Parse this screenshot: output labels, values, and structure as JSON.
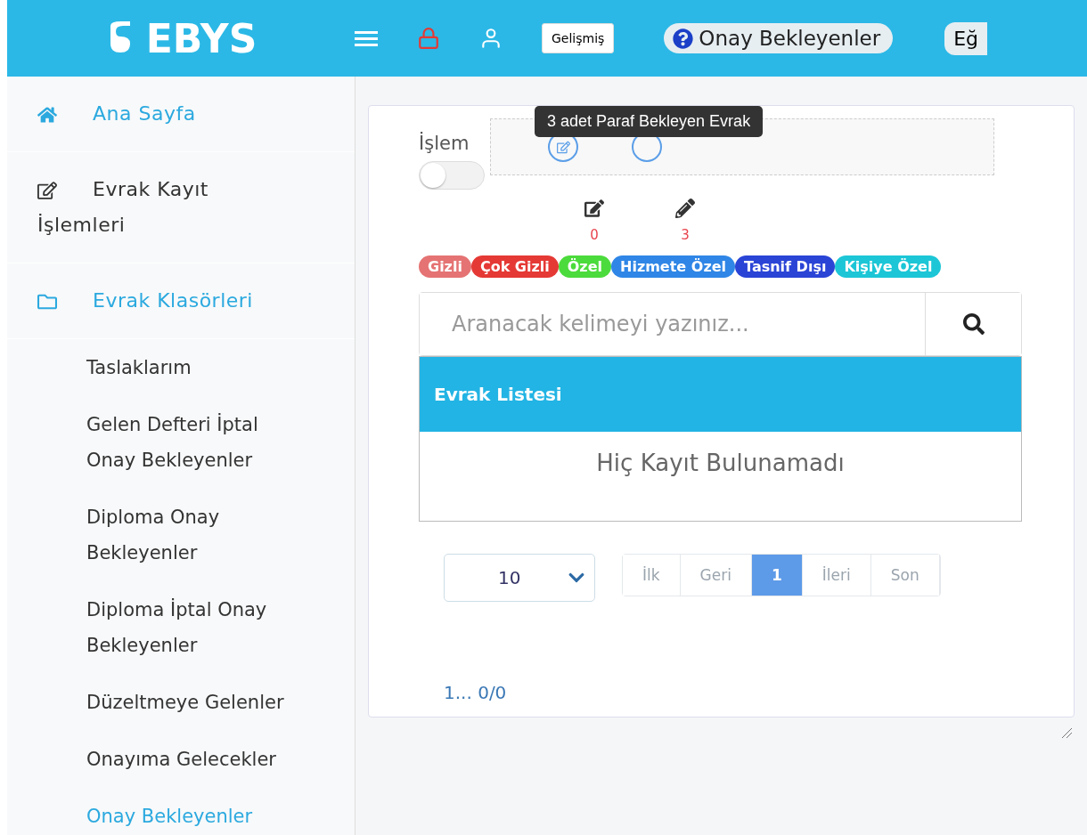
{
  "header": {
    "logo": "EBYS",
    "advanced_button": "Gelişmiş",
    "page_title": "Onay Bekleyenler",
    "cut_button": "Eğ"
  },
  "sidebar": {
    "items": [
      {
        "label": "Ana Sayfa",
        "kind": "home",
        "selected": true
      },
      {
        "label": "Evrak Kayıt İşlemleri",
        "kind": "edit",
        "selected": false
      },
      {
        "label": "Evrak Klasörleri",
        "kind": "folder",
        "selected": true,
        "children": [
          {
            "label": "Taslaklarım",
            "selected": false
          },
          {
            "label": "Gelen Defteri İptal Onay Bekleyenler",
            "selected": false
          },
          {
            "label": "Diploma Onay Bekleyenler",
            "selected": false
          },
          {
            "label": "Diploma İptal Onay Bekleyenler",
            "selected": false
          },
          {
            "label": "Düzeltmeye Gelenler",
            "selected": false
          },
          {
            "label": "Onayıma Gelecekler",
            "selected": false
          },
          {
            "label": "Onay Bekleyenler",
            "selected": true
          }
        ]
      }
    ]
  },
  "content": {
    "operation_label": "İşlem",
    "operation_toggle": {
      "on": false
    },
    "tooltip": "3 adet Paraf Bekleyen Evrak",
    "counters": [
      {
        "kind": "edit",
        "count": "0"
      },
      {
        "kind": "pencil",
        "count": "3"
      }
    ],
    "tags": [
      {
        "label": "Gizli",
        "color": "#e57373"
      },
      {
        "label": "Çok Gizli",
        "color": "#e53935"
      },
      {
        "label": "Özel",
        "color": "#4cdb3c"
      },
      {
        "label": "Hizmete Özel",
        "color": "#2f86e6"
      },
      {
        "label": "Tasnif Dışı",
        "color": "#2a44d6"
      },
      {
        "label": "Kişiye Özel",
        "color": "#1cc6d6"
      }
    ],
    "search": {
      "placeholder": "Aranacak kelimeyi yazınız..."
    },
    "list": {
      "title": "Evrak Listesi",
      "empty": "Hiç Kayıt Bulunamadı"
    },
    "page_size": "10",
    "pagination": [
      {
        "label": "İlk",
        "selected": false
      },
      {
        "label": "Geri",
        "selected": false
      },
      {
        "label": "1",
        "selected": true
      },
      {
        "label": "İleri",
        "selected": false
      },
      {
        "label": "Son",
        "selected": false
      }
    ],
    "summary": "1... 0/0"
  }
}
